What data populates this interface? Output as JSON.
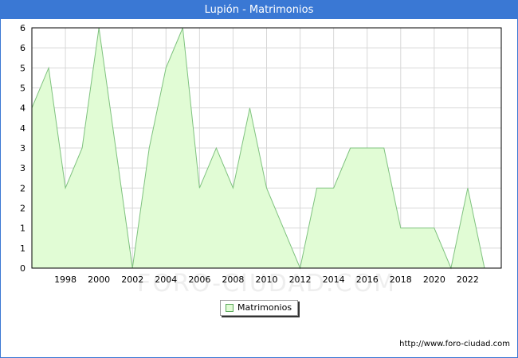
{
  "header": {
    "title": "Lupión - Matrimonios"
  },
  "footer": {
    "url": "http://www.foro-ciudad.com"
  },
  "watermark": {
    "text": "FORO-CIUDAD.COM"
  },
  "colors": {
    "title_bg": "#3a78d4",
    "area_fill": "#e1fcd5",
    "area_line": "#7fc27f",
    "grid": "#d8d8d8"
  },
  "chart_data": {
    "type": "area",
    "title": "Lupión - Matrimonios",
    "x": [
      1996,
      1997,
      1998,
      1999,
      2000,
      2001,
      2002,
      2003,
      2004,
      2005,
      2006,
      2007,
      2008,
      2009,
      2010,
      2011,
      2012,
      2013,
      2014,
      2015,
      2016,
      2017,
      2018,
      2019,
      2020,
      2021,
      2022,
      2023
    ],
    "series": [
      {
        "name": "Matrimonios",
        "values": [
          4,
          5,
          2,
          3,
          6,
          3,
          0,
          3,
          5,
          6,
          2,
          3,
          2,
          4,
          2,
          1,
          0,
          2,
          2,
          3,
          3,
          3,
          1,
          1,
          1,
          0,
          2,
          0
        ]
      }
    ],
    "xticks": [
      "1998",
      "2000",
      "2002",
      "2004",
      "2006",
      "2008",
      "2010",
      "2012",
      "2014",
      "2016",
      "2018",
      "2020",
      "2022"
    ],
    "ytick_labels": [
      "0",
      "1",
      "1",
      "2",
      "2",
      "3",
      "3",
      "4",
      "4",
      "5",
      "5",
      "6",
      "6"
    ],
    "xlim": [
      1996,
      2024
    ],
    "ylim": [
      0,
      6
    ],
    "grid": true,
    "legend": {
      "position": "bottom-center",
      "entries": [
        "Matrimonios"
      ]
    }
  }
}
